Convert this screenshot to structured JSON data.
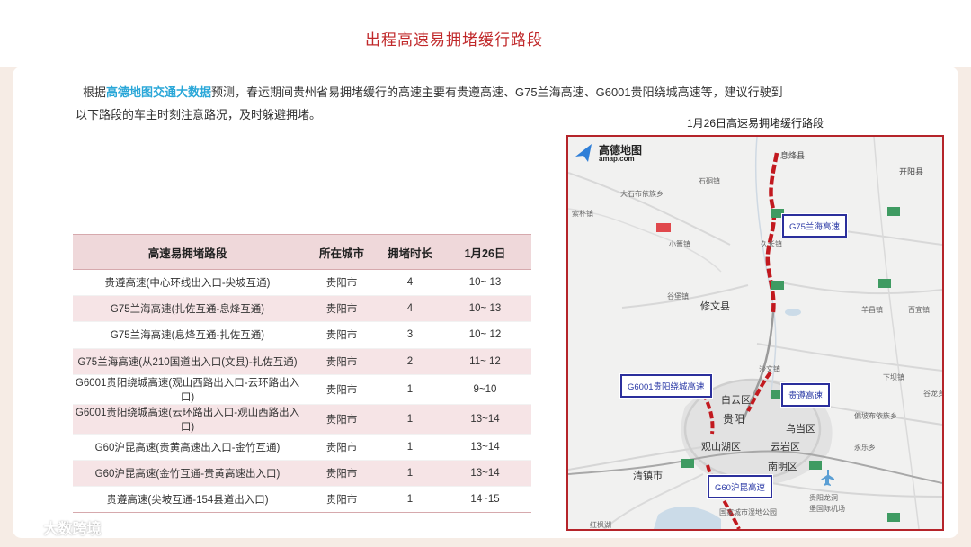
{
  "page": {
    "title": "出程高速易拥堵缓行路段"
  },
  "intro": {
    "prefix": "根据",
    "highlight": "高德地图交通大数据",
    "line1_rest": "预测，春运期间贵州省易拥堵缓行的高速主要有贵遵高速、G75兰海高速、G6001贵阳绕城高速等，建议行驶到",
    "line2": "以下路段的车主时刻注意路况，及时躲避拥堵。"
  },
  "table": {
    "headers": [
      "高速易拥堵路段",
      "所在城市",
      "拥堵时长",
      "1月26日"
    ],
    "rows": [
      [
        "贵遵高速(中心环线出入口-尖坡互通)",
        "贵阳市",
        "4",
        "10~ 13"
      ],
      [
        "G75兰海高速(扎佐互通-息烽互通)",
        "贵阳市",
        "4",
        "10~ 13"
      ],
      [
        "G75兰海高速(息烽互通-扎佐互通)",
        "贵阳市",
        "3",
        "10~ 12"
      ],
      [
        "G75兰海高速(从210国道出入口(文县)-扎佐互通)",
        "贵阳市",
        "2",
        "11~ 12"
      ],
      [
        "G6001贵阳绕城高速(观山西路出入口-云环路出入口)",
        "贵阳市",
        "1",
        "9~10"
      ],
      [
        "G6001贵阳绕城高速(云环路出入口-观山西路出入口)",
        "贵阳市",
        "1",
        "13~14"
      ],
      [
        "G60沪昆高速(贵黄高速出入口-金竹互通)",
        "贵阳市",
        "1",
        "13~14"
      ],
      [
        "G60沪昆高速(金竹互通-贵黄高速出入口)",
        "贵阳市",
        "1",
        "13~14"
      ],
      [
        "贵遵高速(尖坡互通-154县道出入口)",
        "贵阳市",
        "1",
        "14~15"
      ]
    ]
  },
  "map": {
    "caption": "1月26日高速易拥堵缓行路段",
    "logo_name": "高德地图",
    "logo_url": "amap.com",
    "callouts": {
      "g75": "G75兰海高速",
      "g6001": "G6001贵阳绕城高速",
      "guizun": "贵遵高速",
      "g60": "G60沪昆高速"
    },
    "places": {
      "xifeng": "息烽县",
      "kaiyang": "开阳县",
      "dabuwa": "大石布依族乡",
      "shilang": "石硐镇",
      "suopu": "索朴镇",
      "xiaozhai": "小箐镇",
      "jiuzhuang": "久长镇",
      "guzhai": "谷堡镇",
      "xiuwen": "修文县",
      "yangong": "羊昌镇",
      "baigui": "百宜镇",
      "shawen": "沙文镇",
      "xiaba": "下坝镇",
      "guanshanhu_town": "白云区",
      "guiyang": "贵阳",
      "guanshanhu": "观山湖区",
      "wudang": "乌当区",
      "yunyan": "云岩区",
      "nanming": "南明区",
      "qingzhen": "清镇市",
      "gaopo": "偏坡布依族乡",
      "yongle": "永乐乡",
      "gulong": "谷龙乡",
      "airport": "贵阳龙洞堡国际机场",
      "park": "国家城市湿地公园",
      "honghu": "红枫湖",
      "airport_l1": "贵阳龙洞",
      "airport_l2": "堡国际机场"
    }
  },
  "watermark": {
    "text": "大数跨境"
  },
  "colors": {
    "title_red": "#c0282a",
    "highlight_blue": "#2aa7d8",
    "jam_red": "#d0202a",
    "callout_border": "#2b2f9c",
    "row_pink": "#f6e4e6",
    "header_pink": "#efd8da"
  }
}
